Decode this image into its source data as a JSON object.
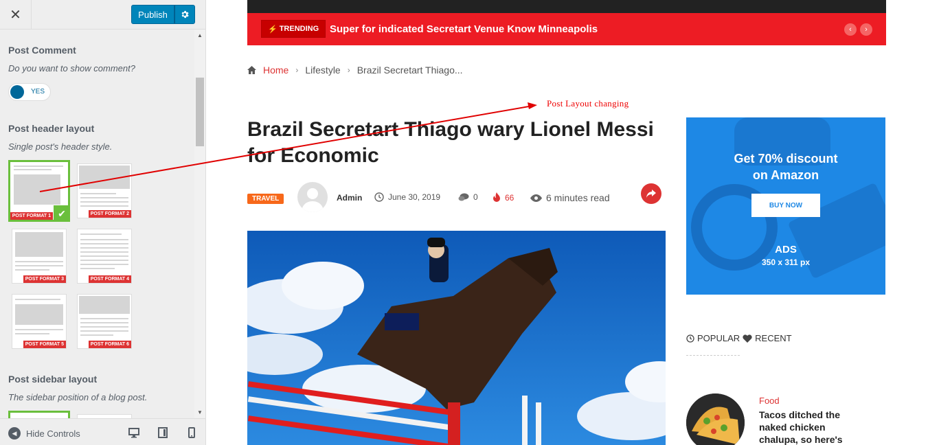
{
  "customizer": {
    "close_label": "✕",
    "publish_label": "Publish",
    "post_comment": {
      "title": "Post Comment",
      "description": "Do you want to show comment?",
      "toggle_label": "YES"
    },
    "header_layout": {
      "title": "Post header layout",
      "description": "Single post's header style.",
      "formats": [
        "POST FORMAT 1",
        "POST FORMAT 2",
        "POST FORMAT 3",
        "POST FORMAT 4",
        "POST FORMAT 5",
        "POST FORMAT 6"
      ],
      "selected_format": "POST FORMAT 1"
    },
    "sidebar_layout": {
      "title": "Post sidebar layout",
      "description": "The sidebar position of a blog post."
    },
    "footer": {
      "hide_controls_label": "Hide Controls"
    }
  },
  "preview": {
    "trending": {
      "badge": "TRENDING",
      "headline": "Super for indicated Secretart Venue Know Minneapolis"
    },
    "breadcrumb": {
      "home": "Home",
      "category": "Lifestyle",
      "current": "Brazil Secretart Thiago..."
    },
    "post": {
      "title": "Brazil Secretart Thiago wary Lionel Messi for Economic",
      "category": "TRAVEL",
      "author": "Admin",
      "date": "June 30, 2019",
      "comments": "0",
      "views_hot": "66",
      "read_time": "6 minutes read"
    },
    "ad": {
      "headline_line1": "Get 70% discount",
      "headline_line2": "on Amazon",
      "button": "BUY NOW",
      "label": "ADS",
      "size": "350 x 311 px"
    },
    "tabs": {
      "popular": "POPULAR",
      "recent": "RECENT"
    },
    "food_post": {
      "category": "Food",
      "title": "Tacos ditched the naked chicken chalupa, so here's"
    }
  },
  "annotation": {
    "text": "Post  Layout changing",
    "color": "#e00000"
  },
  "colors": {
    "accent_red": "#ed1c24",
    "publish_blue": "#0085ba",
    "selected_green": "#6abf3c",
    "ad_blue": "#1e88e5"
  }
}
